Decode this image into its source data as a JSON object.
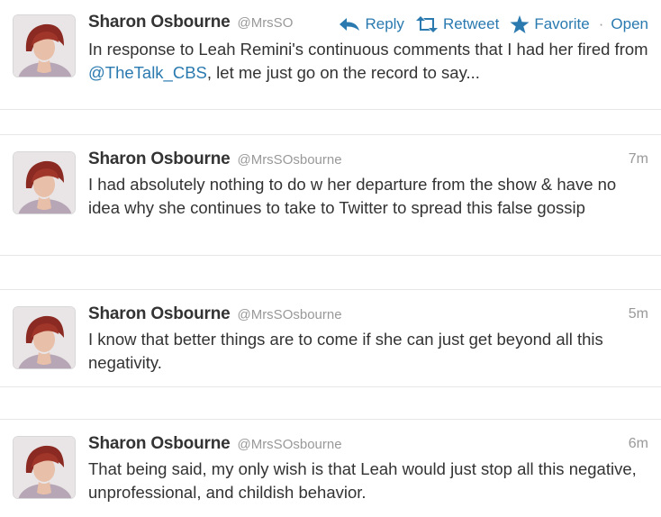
{
  "colors": {
    "link": "#2a7ab0",
    "name": "#333333",
    "muted": "#999999"
  },
  "tweets": [
    {
      "name": "Sharon Osbourne",
      "handle": "@MrsSO",
      "actions": {
        "reply": "Reply",
        "retweet": "Retweet",
        "favorite": "Favorite",
        "separator": "·",
        "open": "Open"
      },
      "text_before": "In response to Leah Remini's continuous comments that I had her fired from ",
      "mention": "@TheTalk_CBS",
      "text_after": ", let me just go on the record to say..."
    },
    {
      "name": "Sharon Osbourne",
      "handle": "@MrsSOsbourne",
      "time": "7m",
      "text": "I had absolutely nothing to do w her departure from the show & have no idea why she continues to take to Twitter to spread this false gossip"
    },
    {
      "name": "Sharon Osbourne",
      "handle": "@MrsSOsbourne",
      "time": "5m",
      "text": "I know that better things are to come if she can just get beyond all this negativity."
    },
    {
      "name": "Sharon Osbourne",
      "handle": "@MrsSOsbourne",
      "time": "6m",
      "text": "That being said, my only wish is that Leah would just stop all this negative, unprofessional, and childish behavior."
    }
  ]
}
